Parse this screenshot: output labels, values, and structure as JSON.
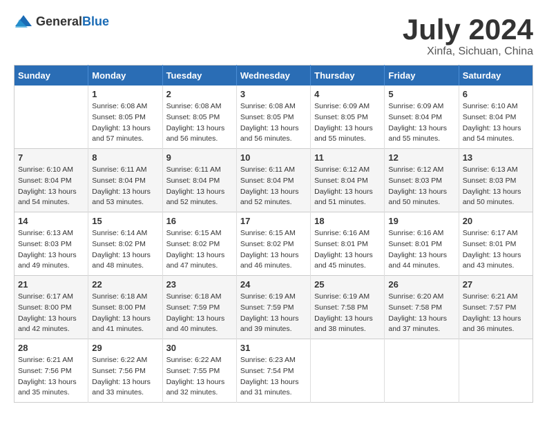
{
  "header": {
    "logo": {
      "general": "General",
      "blue": "Blue"
    },
    "title": "July 2024",
    "location": "Xinfa, Sichuan, China"
  },
  "weekdays": [
    "Sunday",
    "Monday",
    "Tuesday",
    "Wednesday",
    "Thursday",
    "Friday",
    "Saturday"
  ],
  "weeks": [
    [
      {
        "day": "",
        "info": ""
      },
      {
        "day": "1",
        "info": "Sunrise: 6:08 AM\nSunset: 8:05 PM\nDaylight: 13 hours\nand 57 minutes."
      },
      {
        "day": "2",
        "info": "Sunrise: 6:08 AM\nSunset: 8:05 PM\nDaylight: 13 hours\nand 56 minutes."
      },
      {
        "day": "3",
        "info": "Sunrise: 6:08 AM\nSunset: 8:05 PM\nDaylight: 13 hours\nand 56 minutes."
      },
      {
        "day": "4",
        "info": "Sunrise: 6:09 AM\nSunset: 8:05 PM\nDaylight: 13 hours\nand 55 minutes."
      },
      {
        "day": "5",
        "info": "Sunrise: 6:09 AM\nSunset: 8:04 PM\nDaylight: 13 hours\nand 55 minutes."
      },
      {
        "day": "6",
        "info": "Sunrise: 6:10 AM\nSunset: 8:04 PM\nDaylight: 13 hours\nand 54 minutes."
      }
    ],
    [
      {
        "day": "7",
        "info": "Sunrise: 6:10 AM\nSunset: 8:04 PM\nDaylight: 13 hours\nand 54 minutes."
      },
      {
        "day": "8",
        "info": "Sunrise: 6:11 AM\nSunset: 8:04 PM\nDaylight: 13 hours\nand 53 minutes."
      },
      {
        "day": "9",
        "info": "Sunrise: 6:11 AM\nSunset: 8:04 PM\nDaylight: 13 hours\nand 52 minutes."
      },
      {
        "day": "10",
        "info": "Sunrise: 6:11 AM\nSunset: 8:04 PM\nDaylight: 13 hours\nand 52 minutes."
      },
      {
        "day": "11",
        "info": "Sunrise: 6:12 AM\nSunset: 8:04 PM\nDaylight: 13 hours\nand 51 minutes."
      },
      {
        "day": "12",
        "info": "Sunrise: 6:12 AM\nSunset: 8:03 PM\nDaylight: 13 hours\nand 50 minutes."
      },
      {
        "day": "13",
        "info": "Sunrise: 6:13 AM\nSunset: 8:03 PM\nDaylight: 13 hours\nand 50 minutes."
      }
    ],
    [
      {
        "day": "14",
        "info": "Sunrise: 6:13 AM\nSunset: 8:03 PM\nDaylight: 13 hours\nand 49 minutes."
      },
      {
        "day": "15",
        "info": "Sunrise: 6:14 AM\nSunset: 8:02 PM\nDaylight: 13 hours\nand 48 minutes."
      },
      {
        "day": "16",
        "info": "Sunrise: 6:15 AM\nSunset: 8:02 PM\nDaylight: 13 hours\nand 47 minutes."
      },
      {
        "day": "17",
        "info": "Sunrise: 6:15 AM\nSunset: 8:02 PM\nDaylight: 13 hours\nand 46 minutes."
      },
      {
        "day": "18",
        "info": "Sunrise: 6:16 AM\nSunset: 8:01 PM\nDaylight: 13 hours\nand 45 minutes."
      },
      {
        "day": "19",
        "info": "Sunrise: 6:16 AM\nSunset: 8:01 PM\nDaylight: 13 hours\nand 44 minutes."
      },
      {
        "day": "20",
        "info": "Sunrise: 6:17 AM\nSunset: 8:01 PM\nDaylight: 13 hours\nand 43 minutes."
      }
    ],
    [
      {
        "day": "21",
        "info": "Sunrise: 6:17 AM\nSunset: 8:00 PM\nDaylight: 13 hours\nand 42 minutes."
      },
      {
        "day": "22",
        "info": "Sunrise: 6:18 AM\nSunset: 8:00 PM\nDaylight: 13 hours\nand 41 minutes."
      },
      {
        "day": "23",
        "info": "Sunrise: 6:18 AM\nSunset: 7:59 PM\nDaylight: 13 hours\nand 40 minutes."
      },
      {
        "day": "24",
        "info": "Sunrise: 6:19 AM\nSunset: 7:59 PM\nDaylight: 13 hours\nand 39 minutes."
      },
      {
        "day": "25",
        "info": "Sunrise: 6:19 AM\nSunset: 7:58 PM\nDaylight: 13 hours\nand 38 minutes."
      },
      {
        "day": "26",
        "info": "Sunrise: 6:20 AM\nSunset: 7:58 PM\nDaylight: 13 hours\nand 37 minutes."
      },
      {
        "day": "27",
        "info": "Sunrise: 6:21 AM\nSunset: 7:57 PM\nDaylight: 13 hours\nand 36 minutes."
      }
    ],
    [
      {
        "day": "28",
        "info": "Sunrise: 6:21 AM\nSunset: 7:56 PM\nDaylight: 13 hours\nand 35 minutes."
      },
      {
        "day": "29",
        "info": "Sunrise: 6:22 AM\nSunset: 7:56 PM\nDaylight: 13 hours\nand 33 minutes."
      },
      {
        "day": "30",
        "info": "Sunrise: 6:22 AM\nSunset: 7:55 PM\nDaylight: 13 hours\nand 32 minutes."
      },
      {
        "day": "31",
        "info": "Sunrise: 6:23 AM\nSunset: 7:54 PM\nDaylight: 13 hours\nand 31 minutes."
      },
      {
        "day": "",
        "info": ""
      },
      {
        "day": "",
        "info": ""
      },
      {
        "day": "",
        "info": ""
      }
    ]
  ]
}
